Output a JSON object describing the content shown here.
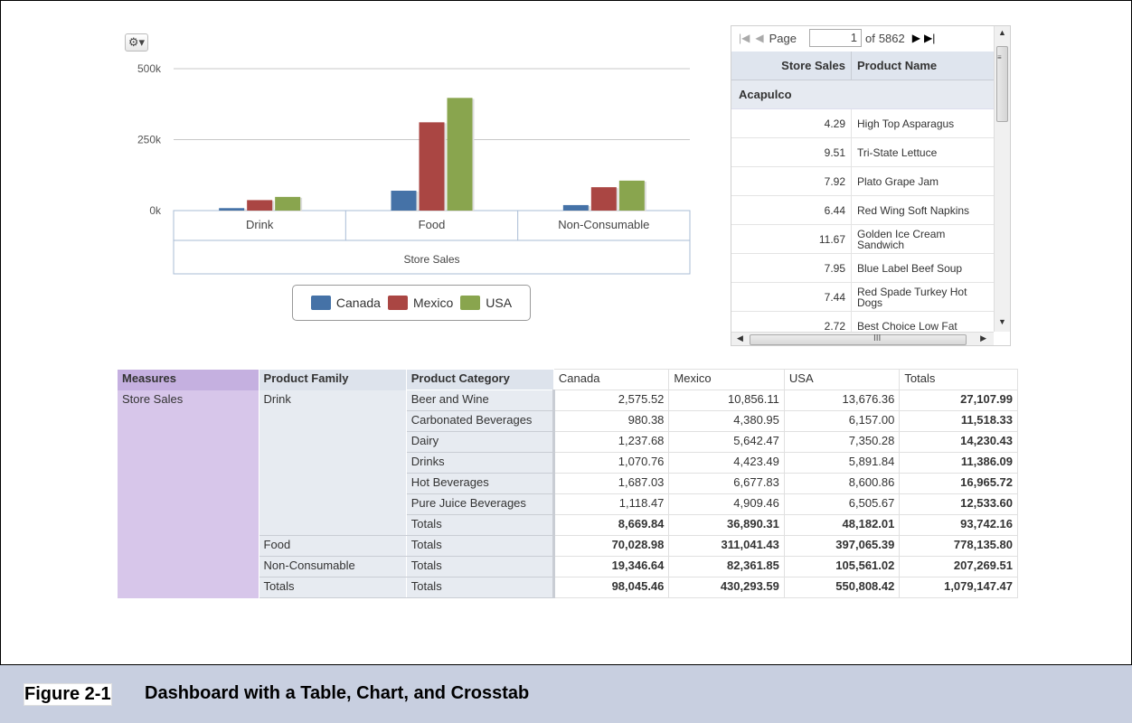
{
  "chart_data": {
    "type": "bar",
    "categories": [
      "Drink",
      "Food",
      "Non-Consumable"
    ],
    "series": [
      {
        "name": "Canada",
        "color": "#4572a7",
        "values": [
          8669.84,
          70028.98,
          19346.64
        ]
      },
      {
        "name": "Mexico",
        "color": "#aa4643",
        "values": [
          36890.31,
          311041.43,
          82361.85
        ]
      },
      {
        "name": "USA",
        "color": "#89a54e",
        "values": [
          48182.01,
          397065.39,
          105561.02
        ]
      }
    ],
    "yticks": [
      "0k",
      "250k",
      "500k"
    ],
    "ylim": [
      0,
      500000
    ],
    "xlabel": "Store Sales",
    "legend_position": "bottom"
  },
  "chart": {
    "gear_icon": "gear-icon",
    "legend": [
      {
        "label": "Canada",
        "color": "#4572a7"
      },
      {
        "label": "Mexico",
        "color": "#aa4643"
      },
      {
        "label": "USA",
        "color": "#89a54e"
      }
    ]
  },
  "table": {
    "pager": {
      "page_label": "Page",
      "page_value": "1",
      "of_label": "of",
      "total_pages": "5862"
    },
    "headers": [
      "Store Sales",
      "Product Name"
    ],
    "group": "Acapulco",
    "rows": [
      {
        "value": "4.29",
        "name": "High Top Asparagus"
      },
      {
        "value": "9.51",
        "name": "Tri-State Lettuce"
      },
      {
        "value": "7.92",
        "name": "Plato Grape Jam"
      },
      {
        "value": "6.44",
        "name": "Red Wing Soft Napkins"
      },
      {
        "value": "11.67",
        "name": "Golden Ice Cream Sandwich"
      },
      {
        "value": "7.95",
        "name": "Blue Label Beef Soup"
      },
      {
        "value": "7.44",
        "name": "Red Spade Turkey Hot Dogs"
      },
      {
        "value": "2.72",
        "name": "Best Choice Low Fat"
      }
    ]
  },
  "crosstab": {
    "headers": [
      "Measures",
      "Product Family",
      "Product Category",
      "Canada",
      "Mexico",
      "USA",
      "Totals"
    ],
    "measure": "Store Sales",
    "drink_family": "Drink",
    "drink_rows": [
      {
        "category": "Beer and Wine",
        "canada": "2,575.52",
        "mexico": "10,856.11",
        "usa": "13,676.36",
        "total": "27,107.99"
      },
      {
        "category": "Carbonated Beverages",
        "canada": "980.38",
        "mexico": "4,380.95",
        "usa": "6,157.00",
        "total": "11,518.33"
      },
      {
        "category": "Dairy",
        "canada": "1,237.68",
        "mexico": "5,642.47",
        "usa": "7,350.28",
        "total": "14,230.43"
      },
      {
        "category": "Drinks",
        "canada": "1,070.76",
        "mexico": "4,423.49",
        "usa": "5,891.84",
        "total": "11,386.09"
      },
      {
        "category": "Hot Beverages",
        "canada": "1,687.03",
        "mexico": "6,677.83",
        "usa": "8,600.86",
        "total": "16,965.72"
      },
      {
        "category": "Pure Juice Beverages",
        "canada": "1,118.47",
        "mexico": "4,909.46",
        "usa": "6,505.67",
        "total": "12,533.60"
      }
    ],
    "drink_totals": {
      "category": "Totals",
      "canada": "8,669.84",
      "mexico": "36,890.31",
      "usa": "48,182.01",
      "total": "93,742.16"
    },
    "family_rows": [
      {
        "family": "Food",
        "category": "Totals",
        "canada": "70,028.98",
        "mexico": "311,041.43",
        "usa": "397,065.39",
        "total": "778,135.80"
      },
      {
        "family": "Non-Consumable",
        "category": "Totals",
        "canada": "19,346.64",
        "mexico": "82,361.85",
        "usa": "105,561.02",
        "total": "207,269.51"
      },
      {
        "family": "Totals",
        "category": "Totals",
        "canada": "98,045.46",
        "mexico": "430,293.59",
        "usa": "550,808.42",
        "total": "1,079,147.47"
      }
    ]
  },
  "caption": {
    "number": "Figure 2-1",
    "text": "Dashboard with a Table, Chart, and Crosstab"
  }
}
